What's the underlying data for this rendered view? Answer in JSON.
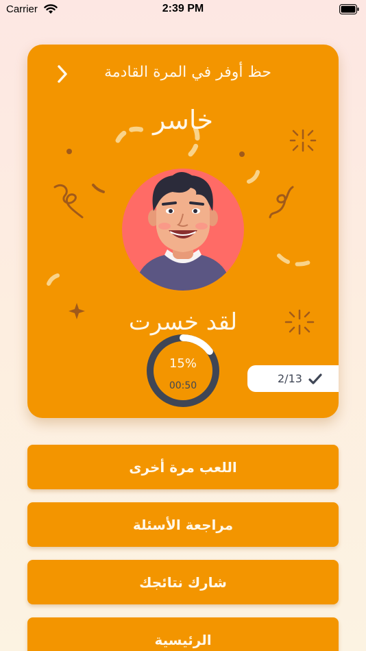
{
  "status_bar": {
    "carrier": "Carrier",
    "time": "2:39 PM"
  },
  "card": {
    "subtitle": "حظ أوفر في المرة القادمة",
    "result_title": "خاسر",
    "lost_message": "لقد خسرت",
    "progress": {
      "percent_label": "15%",
      "fraction": 0.15,
      "timer": "00:50"
    },
    "score": "2/13",
    "icons": {
      "back": "chevron-right-icon",
      "score": "check-icon",
      "avatar": "avatar-boy"
    }
  },
  "buttons": [
    {
      "label": "اللعب مرة أخرى"
    },
    {
      "label": "مراجعة الأسئلة"
    },
    {
      "label": "شارك نتائجك"
    },
    {
      "label": "الرئيسية"
    }
  ],
  "colors": {
    "card": "#f39500",
    "text": "#fff8ea",
    "ring_track": "#3f4655",
    "ring_fill": "#ffffff",
    "avatar_bg": "#ff6b66"
  }
}
